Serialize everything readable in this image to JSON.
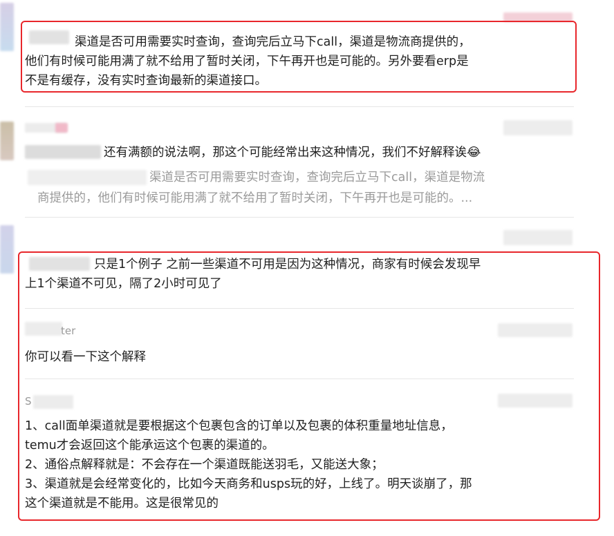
{
  "messages": [
    {
      "lines": [
        "渠道是否可用需要实时查询，查询完后立马下call，渠道是物流商提供的，",
        "他们有时候可能用满了就不给用了暂时关闭，下午再开也是可能的。另外要看erp是",
        "不是有缓存，没有实时查询最新的渠道接口。"
      ]
    },
    {
      "text": "还有满额的说法啊，那这个可能经常出来这种情况，我们不好解释诶😂",
      "quote_lines": [
        "渠道是否可用需要实时查询，查询完后立马下call，渠道是物流",
        "商提供的，他们有时候可能用满了就不给用了暂时关闭，下午再开也是可能的。..."
      ]
    },
    {
      "lines": [
        "只是1个例子 之前一些渠道不可用是因为这种情况，商家有时候会发现早",
        "上1个渠道不可见，隔了2小时可见了"
      ]
    },
    {
      "sender_fragment": "ter",
      "text": "你可以看一下这个解释"
    },
    {
      "sender_fragment": "S",
      "lines": [
        "1、call面单渠道就是要根据这个包裹包含的订单以及包裹的体积重量地址信息，",
        "temu才会返回这个能承运这个包裹的渠道的。",
        "2、通俗点解释就是：不会存在一个渠道既能送羽毛，又能送大象；",
        "3、渠道就是会经常变化的，比如今天商务和usps玩的好，上线了。明天谈崩了，那",
        "这个渠道就是不能用。这是很常见的"
      ]
    }
  ],
  "colors": {
    "highlight": "#e8262b",
    "quote": "#9a9a9a",
    "text": "#1f1f1f"
  }
}
